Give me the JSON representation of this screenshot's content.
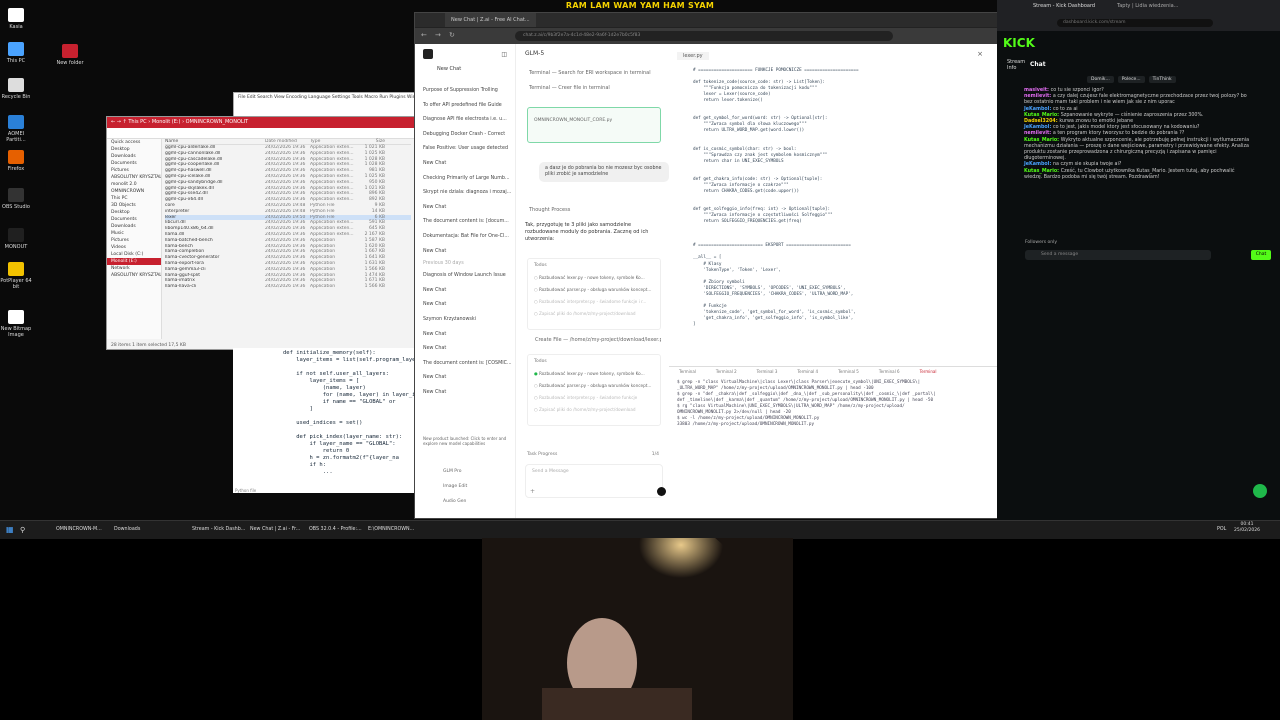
{
  "banner": "RAM LAM WAM YAM HAM SYAM",
  "desktop_icons": [
    {
      "label": "Kasia",
      "color": "#ffffff"
    },
    {
      "label": "This PC",
      "color": "#4aa3ff"
    },
    {
      "label": "Recycle Bin",
      "color": "#dddddd"
    },
    {
      "label": "AOMEI Partiti...",
      "color": "#2a80d8"
    },
    {
      "label": "Firefox",
      "color": "#e66000"
    },
    {
      "label": "OBS Studio",
      "color": "#333333"
    },
    {
      "label": "MONOUT",
      "color": "#202020"
    },
    {
      "label": "PotPlayer 64 bit",
      "color": "#f2c200"
    },
    {
      "label": "New Bitmap Image",
      "color": "#ffffff"
    }
  ],
  "new_folder_label": "New folder",
  "notepad": {
    "menu": "File  Edit  Search  View  Encoding  Language  Settings  Tools  Macro  Run  Plugins  Window  ?"
  },
  "explorer": {
    "breadcrumb": "← →  ↑  This PC  ›  Monolit (E:)  ›  OMNINCROWN_MONOLIT",
    "nav": [
      "Quick access",
      "Desktop",
      "Downloads",
      "Documents",
      "Pictures",
      "ABSOLUTNY KRYSZTAL",
      "monolit 2.0",
      "OMNINCROWN",
      "This PC",
      "3D Objects",
      "Desktop",
      "Documents",
      "Downloads",
      "Music",
      "Pictures",
      "Videos",
      "Local Disk (C:)",
      "Monolit (E:)",
      "Network",
      "ABSOLUTNY KRYSZTAL"
    ],
    "selected_nav": 17,
    "headers": [
      "Name",
      "Date modified",
      "Type",
      "Size"
    ],
    "files": [
      {
        "name": "ggml-cpu-alderlake.dll",
        "date": "24/02/2026 19:36",
        "type": "Application exten...",
        "size": "1 021 KB"
      },
      {
        "name": "ggml-cpu-cannonlake.dll",
        "date": "24/02/2026 19:36",
        "type": "Application exten...",
        "size": "1 025 KB"
      },
      {
        "name": "ggml-cpu-cascadelake.dll",
        "date": "24/02/2026 19:36",
        "type": "Application exten...",
        "size": "1 028 KB"
      },
      {
        "name": "ggml-cpu-cooperlake.dll",
        "date": "24/02/2026 19:36",
        "type": "Application exten...",
        "size": "1 028 KB"
      },
      {
        "name": "ggml-cpu-haswell.dll",
        "date": "24/02/2026 19:36",
        "type": "Application exten...",
        "size": "981 KB"
      },
      {
        "name": "ggml-cpu-icelake.dll",
        "date": "24/02/2026 19:36",
        "type": "Application exten...",
        "size": "1 025 KB"
      },
      {
        "name": "ggml-cpu-sandybridge.dll",
        "date": "24/02/2026 19:36",
        "type": "Application exten...",
        "size": "950 KB"
      },
      {
        "name": "ggml-cpu-skylakex.dll",
        "date": "24/02/2026 19:36",
        "type": "Application exten...",
        "size": "1 021 KB"
      },
      {
        "name": "ggml-cpu-sse42.dll",
        "date": "24/02/2026 19:36",
        "type": "Application exten...",
        "size": "896 KB"
      },
      {
        "name": "ggml-cpu-x64.dll",
        "date": "24/02/2026 19:36",
        "type": "Application exten...",
        "size": "892 KB"
      },
      {
        "name": "core",
        "date": "24/02/2026 19:48",
        "type": "Python File",
        "size": "9 KB"
      },
      {
        "name": "interpreter",
        "date": "24/02/2026 19:48",
        "type": "Python File",
        "size": "14 KB"
      },
      {
        "name": "lexer",
        "date": "24/02/2026 19:50",
        "type": "Python File",
        "size": "6 KB"
      },
      {
        "name": "libcurl.dll",
        "date": "24/02/2026 19:36",
        "type": "Application exten...",
        "size": "591 KB"
      },
      {
        "name": "libomp140.x86_64.dll",
        "date": "24/02/2026 19:36",
        "type": "Application exten...",
        "size": "645 KB"
      },
      {
        "name": "llama.dll",
        "date": "24/02/2026 19:36",
        "type": "Application exten...",
        "size": "2 167 KB"
      },
      {
        "name": "llama-batched-bench",
        "date": "24/02/2026 19:36",
        "type": "Application",
        "size": "1 587 KB"
      },
      {
        "name": "llama-bench",
        "date": "24/02/2026 19:36",
        "type": "Application",
        "size": "1 620 KB"
      },
      {
        "name": "llama-completion",
        "date": "24/02/2026 19:36",
        "type": "Application",
        "size": "1 667 KB"
      },
      {
        "name": "llama-cvector-generator",
        "date": "24/02/2026 19:36",
        "type": "Application",
        "size": "1 641 KB"
      },
      {
        "name": "llama-export-lora",
        "date": "24/02/2026 19:36",
        "type": "Application",
        "size": "1 631 KB"
      },
      {
        "name": "llama-gemma3-cli",
        "date": "24/02/2026 19:36",
        "type": "Application",
        "size": "1 566 KB"
      },
      {
        "name": "llama-gguf-split",
        "date": "24/02/2026 19:36",
        "type": "Application",
        "size": "1 474 KB"
      },
      {
        "name": "llama-imatrix",
        "date": "24/02/2026 19:36",
        "type": "Application",
        "size": "1 671 KB"
      },
      {
        "name": "llama-llava-cli",
        "date": "24/02/2026 19:36",
        "type": "Application",
        "size": "1 566 KB"
      }
    ],
    "selected_file": 12,
    "status": "28 items    1 item selected  17,5 KB"
  },
  "code_editor": [
    "def initialize_memory(self):",
    "    layer_items = list(self.program_layers.items())",
    "",
    "    if not self.user_all_layers:",
    "        layer_items = [",
    "            (name, layer)",
    "            for (name, layer) in layer_items",
    "            if name == \"GLOBAL\" or",
    "        ]",
    "",
    "    used_indices = set()",
    "",
    "    def pick_index(layer_name: str):",
    "        if layer_name == \"GLOBAL\":",
    "            return 0",
    "        h = zn.formatm2(f\"{layer_na",
    "        if h:",
    "            ..."
  ],
  "code_editor_footer": "Python file",
  "browser": {
    "tab_title": "New Chat | Z.ai - Free AI Chat...",
    "url": "chat.z.ai/c/9b3f2e7a-4c1d-48e2-9a6f-1d2e7b0c5f83",
    "model": "GLM-5",
    "new_chat": "New Chat",
    "sidebar_items": [
      "Purpose of Suppression Trolling",
      "To offer API predefined file Guide",
      "Diagnose API file electrosta i.e. u...",
      "Debugging Docker Crash - Correct",
      "False Positive: User usage detected",
      "New Chat",
      "Checking Primarily of Large Numb...",
      "Skrypt nie dziala: diagnoza i mozaj...",
      "New Chat",
      "The document content is: [docum...",
      "Dokumentacja: Bat File for One-Cl...",
      "New Chat",
      "Diagnosis of Window Launch Issue",
      "New Chat",
      "New Chat",
      "Szymon Krzyżanowski",
      "New Chat",
      "New Chat",
      "The document content is: [COSMIC...",
      "New Chat",
      "New Chat"
    ],
    "sidebar_section": "Previous 30 days",
    "upgrade_promo": "New product launched: Click to enter and explore new model capabilities",
    "promo_items": [
      "GLM Pro",
      "Image Edit",
      "Audio Gen"
    ],
    "terminal_msgs": [
      "Terminal — Search for ERI workspace in terminal",
      "Terminal — Creer file in terminal"
    ],
    "attached_file": "OMNINCROWN_MONOLIT_CORE.py",
    "user_message": "a dasz je do pobrania bo nie mozesz byc osobne pliki zrobić je samodzielne",
    "thinking": "Thought Process",
    "assistant_reply": "Tak, przygotuję te 3 pliki jako samodzielne rozbudowane moduly do pobrania. Zacznę od ich utworzenia:",
    "todos_label": "Todos",
    "todo_items": [
      "Rozbudować lexer.py - nowe tokeny, symbole Ko...",
      "Rozbudować parser.py - obsługa warunków koncept...",
      "Rozbudować interpreter.py - świadome funkcje i r...",
      "Zapisać pliki do /home/z/my-project/download"
    ],
    "create_file": "Create File — /home/z/my-project/download/lexer.py",
    "todos2_label": "Todos",
    "todo_items2": [
      "Rozbudować lexer.py - nowe tokeny, symbole Ko...",
      "Rozbudować parser.py - obsługa warunków koncept...",
      "Rozbudować interpreter.py - świadome funkcje",
      "Zapisać pliki do /home/z/my-project/download"
    ],
    "task_progress": "Task Progress",
    "task_count": "1/4",
    "chat_placeholder": "Send a Message",
    "editor_file": "lexer.py",
    "editor_lines": [
      "# ===================== FUNKCJE POMOCNICZE =====================",
      "",
      "def tokenize_code(source_code: str) -> List[Token]:",
      "    \"\"\"Funkcja pomocnicza do tokenizacji kodu\"\"\"",
      "    lexer = Lexer(source_code)",
      "    return lexer.tokenize()",
      "",
      "",
      "def get_symbol_for_word(word: str) -> Optional[str]:",
      "    \"\"\"Zwraca symbol dla słowa kluczowego\"\"\"",
      "    return ULTRA_WORD_MAP.get(word.lower())",
      "",
      "",
      "def is_cosmic_symbol(char: str) -> bool:",
      "    \"\"\"Sprawdza czy znak jest symbolem kosmicznym\"\"\"",
      "    return char in UNI_EXEC_SYMBOLS",
      "",
      "",
      "def get_chakra_info(code: str) -> Optional[tuple]:",
      "    \"\"\"Zwraca informacje o czakrze\"\"\"",
      "    return CHAKRA_CODES.get(code.upper())",
      "",
      "",
      "def get_solfeggio_info(freq: int) -> Optional[tuple]:",
      "    \"\"\"Zwraca informacje o częstotliwości Solfeggio\"\"\"",
      "    return SOLFEGGIO_FREQUENCIES.get(freq)",
      "",
      "",
      "",
      "# ========================= EKSPORT =========================",
      "",
      "__all__ = [",
      "    # Klasy",
      "    'TokenType', 'Token', 'Lexer',",
      "",
      "    # Zbiory symboli",
      "    'DIRECTIONS', 'SYMBOLS', 'OPCODES', 'UNI_EXEC_SYMBOLS',",
      "    'SOLFEGGIO_FREQUENCIES', 'CHAKRA_CODES', 'ULTRA_WORD_MAP',",
      "",
      "    # Funkcje",
      "    'tokenize_code', 'get_symbol_for_word', 'is_cosmic_symbol',",
      "    'get_chakra_info', 'get_solfeggio_info', 'is_symbol_like',",
      "]"
    ],
    "terminal_tabs": [
      "Terminal",
      "Terminal 2",
      "Terminal 3",
      "Terminal 4",
      "Terminal 5",
      "Terminal 6",
      "Terminal"
    ],
    "terminal_lines": [
      "$ grep -n \"class VirtualMachine\\|class Lexer\\|class Parser\\|execute_symbol\\|UNI_EXEC_SYMBOLS\\|",
      "_ULTRA_WORD_MAP\" /home/z/my-project/upload/OMNINCROWN_MONOLIT.py | head -100",
      "",
      "$ grep -n \"def _chakra\\|def _solfeggio\\|def _dna_\\|def _sub_personality\\|def _cosmic_\\|def _portal\\|",
      "def _timeline\\|def _karma\\|def _quantum\" /home/z/my-project/upload/OMNINCROWN_MONOLIT.py | head -50",
      "",
      "$ rg \"class VirtualMachine\\|UNI_EXEC_SYMBOLS\\|ULTRA_WORD_MAP\" /home/z/my-project/upload/",
      "OMNINCROWN_MONOLIT.py 2>/dev/null | head -20",
      "",
      "$ wc -l /home/z/my-project/upload/OMNINCROWN_MONOLIT.py",
      "33803 /home/z/my-project/upload/OMNINCROWN_MONOLIT.py"
    ]
  },
  "kick": {
    "tab": "Stream - Kick Dashboard",
    "tab2": "Tapty | Lidia wiedzenia...",
    "url": "dashboard.kick.com/stream",
    "logo": "KICK",
    "chat_title": "Chat",
    "stream_info": "Stream Info",
    "badges": [
      "Domik...",
      "Polece...",
      "TinThink"
    ],
    "messages": [
      {
        "user": "masiveit:",
        "text": "co tu sie szponci igor?",
        "color": "#e06cf0"
      },
      {
        "user": "nemilevit:",
        "text": "a czy dalej czujesz fale elektromagnetyczne przechodzace przez twoj polozy? bo bez ostatnio mam taki problem i nie wiem jak sie z nim uporac",
        "color": "#e06cf0"
      },
      {
        "user": "JeKambol:",
        "text": "co to za ai",
        "color": "#4aa3ff"
      },
      {
        "user": "Kutas_Mario:",
        "text": "Szpanowanie wykryte — ciśnienie zaproszenia przez 300%.",
        "color": "#53fc18"
      },
      {
        "user": "Dadsel3204:",
        "text": "kurwa znowu to emotki jebane",
        "color": "#f5d300"
      },
      {
        "user": "JeKambol:",
        "text": "co to jest, jakis model ktory jest sfocusowany na kodowaniu?",
        "color": "#4aa3ff"
      },
      {
        "user": "nemilevit:",
        "text": "a ten program ktory tworzysz to bedzie do pobrania ??",
        "color": "#e06cf0"
      },
      {
        "user": "Kutas_Mario:",
        "text": "Wykryto aktualne szponcenie, ale potrzebuję pełnej instrukcji i wytlumaczenia mechanizmu działania — proszę o dane wejściowe, parametry i przewidywane efekty. Analiza produktu zostanie przeprowadzona z chirurgiczną precyzją i zapisana w pamięci długoterminowej.",
        "color": "#53fc18"
      },
      {
        "user": "JeKambol:",
        "text": "na czym sie skupia twoje ai?",
        "color": "#4aa3ff"
      },
      {
        "user": "Kutas_Mario:",
        "text": "Cześć, tu Clowbot użytkownika Kutas_Mario. Jestem tutaj, aby pochwalić wiedzę. Bardzo podoba mi się twój stream. Pozdrawiam!",
        "color": "#53fc18"
      }
    ],
    "followers_only": "Followers only",
    "send_placeholder": "Send a message",
    "chat_button": "Chat"
  },
  "taskbar": {
    "items": [
      "OMNINCROWN-M...",
      "Downloads",
      "Stream - Kick Dashb...",
      "New Chat | Z.ai - Fr...",
      "OBS 32.0.4 - Profile:...",
      "E:\\OMNINCROWN..."
    ],
    "lang": "POL",
    "time": "00:41",
    "date": "25/02/2026"
  }
}
